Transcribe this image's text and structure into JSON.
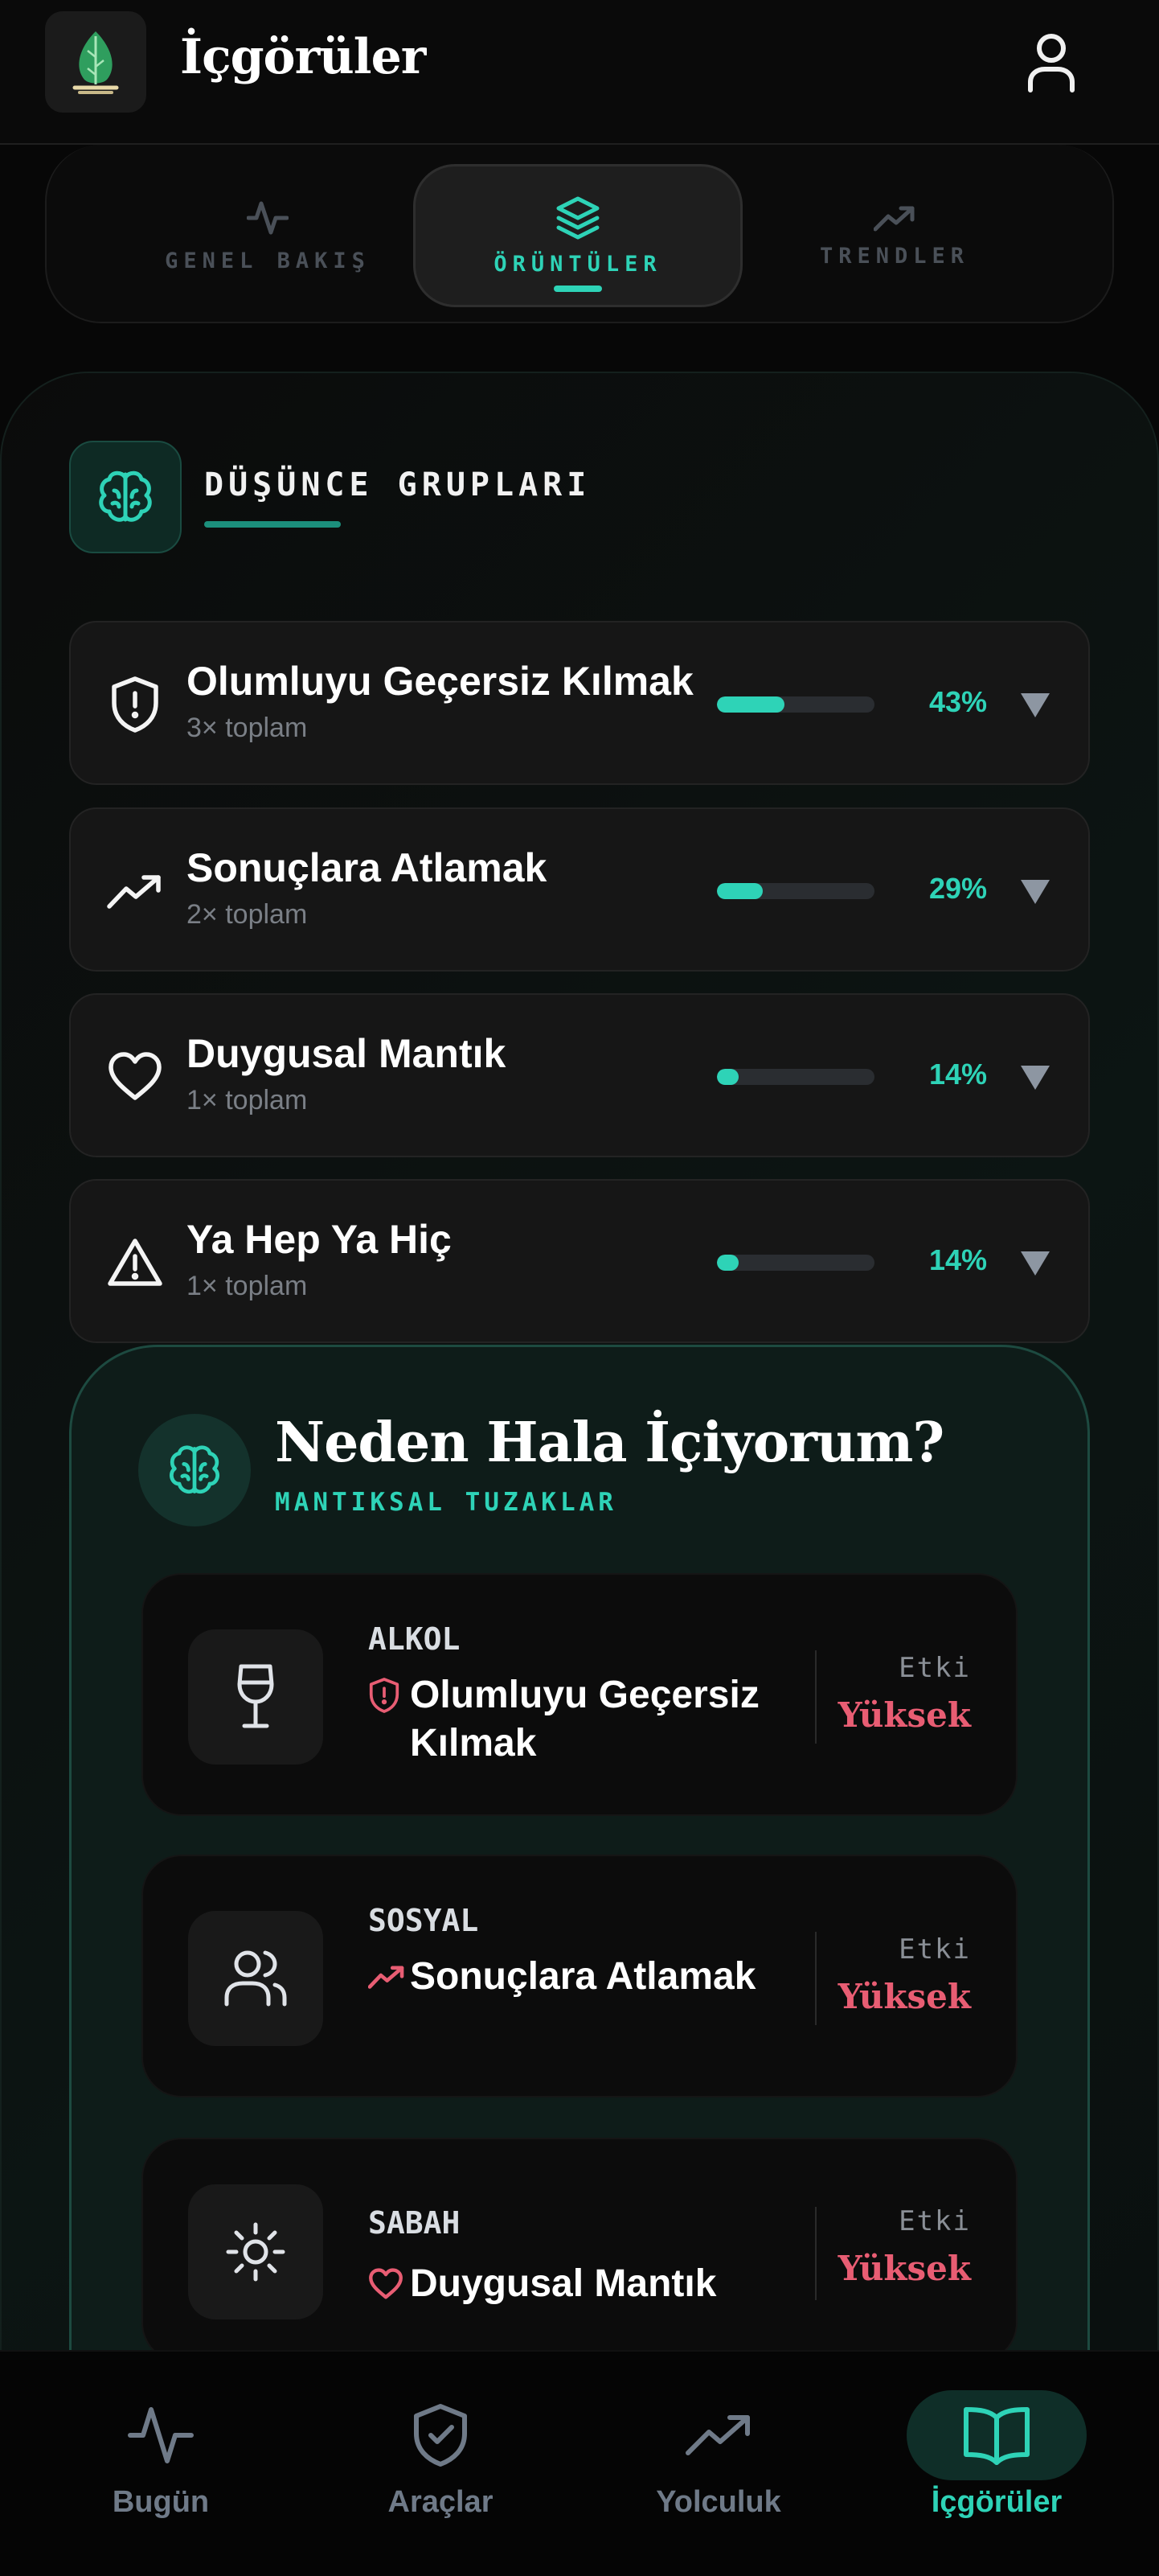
{
  "colors": {
    "accent": "#2ed3b7",
    "background": "#070707",
    "card": "#161616",
    "danger": "#e85d73",
    "muted": "#6f7a88"
  },
  "header": {
    "title": "İçgörüler",
    "logo_icon": "leaf-icon",
    "user_icon": "user-icon"
  },
  "tabs": [
    {
      "label": "GENEL BAKIŞ",
      "icon": "activity-icon",
      "active": false
    },
    {
      "label": "ÖRÜNTÜLER",
      "icon": "layers-icon",
      "active": true
    },
    {
      "label": "TRENDLER",
      "icon": "trending-up-icon",
      "active": false
    }
  ],
  "groups_section": {
    "title": "DÜŞÜNCE GRUPLARI",
    "icon": "brain-icon",
    "items": [
      {
        "name": "Olumluyu Geçersiz Kılmak",
        "count": "3× toplam",
        "percent": "43%",
        "fraction": 0.43,
        "icon": "shield-alert-icon"
      },
      {
        "name": "Sonuçlara Atlamak",
        "count": "2× toplam",
        "percent": "29%",
        "fraction": 0.29,
        "icon": "trending-up-icon"
      },
      {
        "name": "Duygusal Mantık",
        "count": "1× toplam",
        "percent": "14%",
        "fraction": 0.14,
        "icon": "heart-icon"
      },
      {
        "name": "Ya Hep Ya Hiç",
        "count": "1× toplam",
        "percent": "14%",
        "fraction": 0.14,
        "icon": "warning-icon"
      }
    ]
  },
  "why_section": {
    "title": "Neden Hala İçiyorum?",
    "subtitle": "MANTIKSAL TUZAKLAR",
    "icon": "brain-icon",
    "items": [
      {
        "category": "ALKOL",
        "trap": "Olumluyu Geçersiz Kılmak",
        "impact_label": "Etki",
        "impact": "Yüksek",
        "icon": "wine-glass-icon",
        "trap_icon": "shield-alert-icon"
      },
      {
        "category": "SOSYAL",
        "trap": "Sonuçlara Atlamak",
        "impact_label": "Etki",
        "impact": "Yüksek",
        "icon": "users-icon",
        "trap_icon": "trending-up-icon"
      },
      {
        "category": "SABAH",
        "trap": "Duygusal Mantık",
        "impact_label": "Etki",
        "impact": "Yüksek",
        "icon": "sun-icon",
        "trap_icon": "heart-icon"
      }
    ]
  },
  "bottom_nav": [
    {
      "label": "Bugün",
      "icon": "activity-icon",
      "active": false
    },
    {
      "label": "Araçlar",
      "icon": "shield-check-icon",
      "active": false
    },
    {
      "label": "Yolculuk",
      "icon": "trending-up-icon",
      "active": false
    },
    {
      "label": "İçgörüler",
      "icon": "book-open-icon",
      "active": true
    }
  ]
}
